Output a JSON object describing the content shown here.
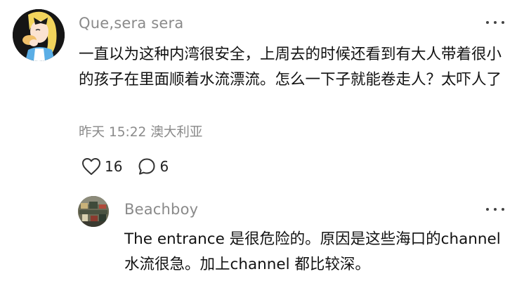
{
  "comment": {
    "username": "Que,sera sera",
    "text": "一直以为这种内湾很安全，上周去的时候还看到有大人带着很小的孩子在里面顺着水流漂流。怎么一下子就能卷走人？太吓人了",
    "date": "昨天",
    "time": "15:22",
    "location": "澳大利亚",
    "likes": "16",
    "replies": "6",
    "icons": {
      "like": "heart-outline-icon",
      "reply": "speech-bubble-icon",
      "more": "ellipsis-icon"
    }
  },
  "reply": {
    "username": "Beachboy",
    "text": "The entrance 是很危险的。原因是这些海口的channel 水流很急。加上channel 都比较深。"
  },
  "colors": {
    "text_primary": "#111111",
    "text_secondary": "#8a8a8a",
    "background": "#ffffff"
  }
}
